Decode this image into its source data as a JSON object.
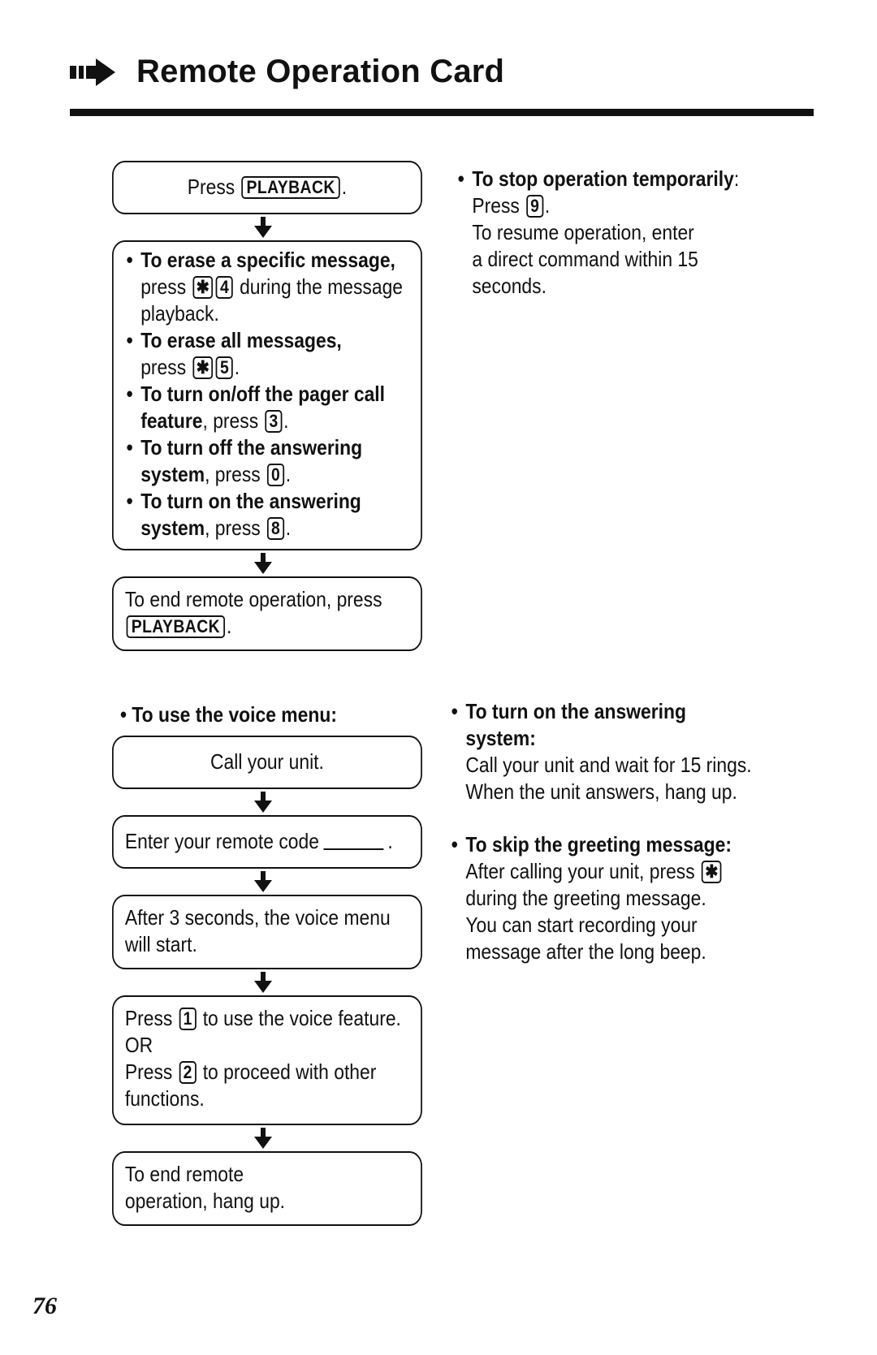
{
  "header": {
    "icon": "right-arrow-icon",
    "title": "Remote Operation Card"
  },
  "flow1": {
    "step1": {
      "pre": "Press",
      "key": "PLAYBACK",
      "post": "."
    },
    "step2": {
      "items": [
        {
          "bold": "To erase a specific message,",
          "pre": "press",
          "keys": [
            "✱",
            "4"
          ],
          "post": "during the message playback."
        },
        {
          "bold": "To erase all messages,",
          "pre": "press",
          "keys": [
            "✱",
            "5"
          ],
          "post": "."
        },
        {
          "bold": "To turn on/off the pager call feature",
          "pre": ", press",
          "keys": [
            "3"
          ],
          "post": "."
        },
        {
          "bold": "To turn off the answering system",
          "pre": ", press",
          "keys": [
            "0"
          ],
          "post": "."
        },
        {
          "bold": "To turn on the answering system",
          "pre": ", press",
          "keys": [
            "8"
          ],
          "post": "."
        }
      ]
    },
    "step3": {
      "pre": "To end remote operation, press",
      "key": "PLAYBACK",
      "post": "."
    }
  },
  "right_top": {
    "heading": "To stop operation temporarily",
    "heading_suffix": ":",
    "press_pre": "Press",
    "press_key": "9",
    "press_post": ".",
    "text": "To resume operation, enter a direct command within 15 seconds."
  },
  "voice_menu": {
    "label": "To use the voice menu:",
    "step1": "Call your unit.",
    "step2": {
      "text": "Enter your remote code",
      "post": "."
    },
    "step3": "After 3 seconds, the voice menu will start.",
    "step4": {
      "line1_pre": "Press",
      "line1_key": "1",
      "line1_post": "to use the voice feature.",
      "or": "OR",
      "line2_pre": "Press",
      "line2_key": "2",
      "line2_post": "to proceed with other functions."
    },
    "step5": "To end remote operation, hang up."
  },
  "right_bottom": {
    "item1": {
      "heading": "To turn on the answering system:",
      "text": "Call your unit and wait for 15 rings. When the unit answers, hang up."
    },
    "item2": {
      "heading": "To skip the greeting message:",
      "pre": "After calling your unit, press",
      "key": "✱",
      "post": "during the greeting message. You can start recording your message after the long beep."
    }
  },
  "page_number": "76"
}
